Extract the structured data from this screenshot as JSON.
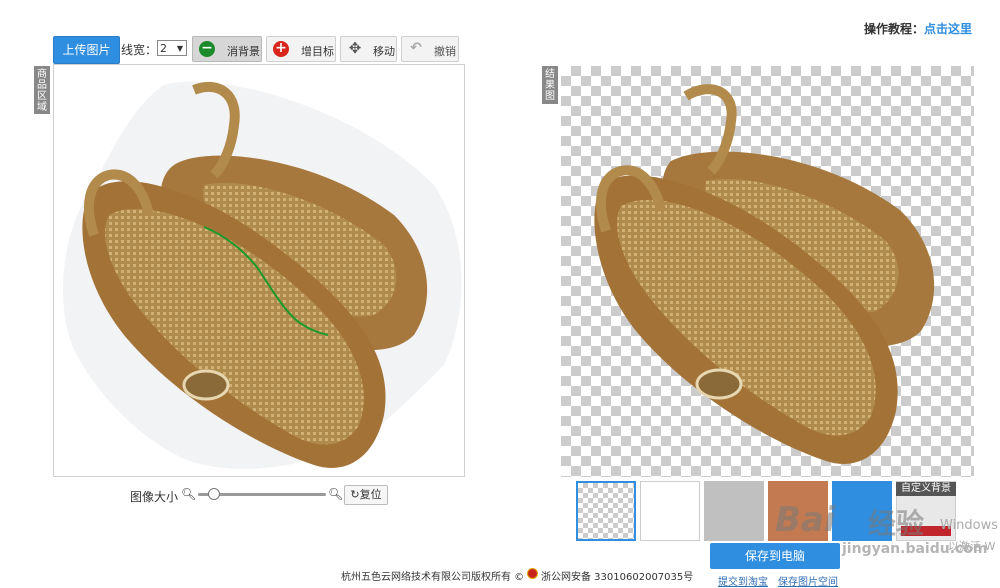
{
  "toolbar": {
    "upload_label": "上传图片",
    "line_width_label": "线宽：",
    "line_width_value": "2",
    "erase_bg_label": "消背景",
    "add_target_label": "增目标",
    "move_label": "移动",
    "undo_label": "撤销"
  },
  "tutorial": {
    "prefix": "操作教程：",
    "link": "点击这里"
  },
  "left_panel": {
    "tag": "商品区域"
  },
  "right_panel": {
    "tag": "结果图"
  },
  "zoom": {
    "label": "图像大小",
    "reset_label": "复位"
  },
  "backgrounds": {
    "custom_label": "自定义背景",
    "swatch_colors": [
      "#ffffff",
      "#c0c0c0",
      "#c47a50",
      "#2f8ee0"
    ]
  },
  "save": {
    "button_label": "保存到电脑",
    "link_taobao": "提交到淘宝",
    "link_space": "保存图片空间"
  },
  "footer": {
    "copyright": "杭州五色云网络技术有限公司版权所有 ©",
    "police": "浙公网安备 33010602007035号"
  },
  "watermark": {
    "brand": "Bai",
    "brand2": "经验",
    "url": "jingyan.baidu.com",
    "os_line": "Windows",
    "activate_line": "以激活 W"
  },
  "colors": {
    "accent": "#2f8ee0",
    "erase_icon": "#1a8a2a",
    "add_icon": "#d9261c",
    "stroke": "#1a9a2a"
  }
}
